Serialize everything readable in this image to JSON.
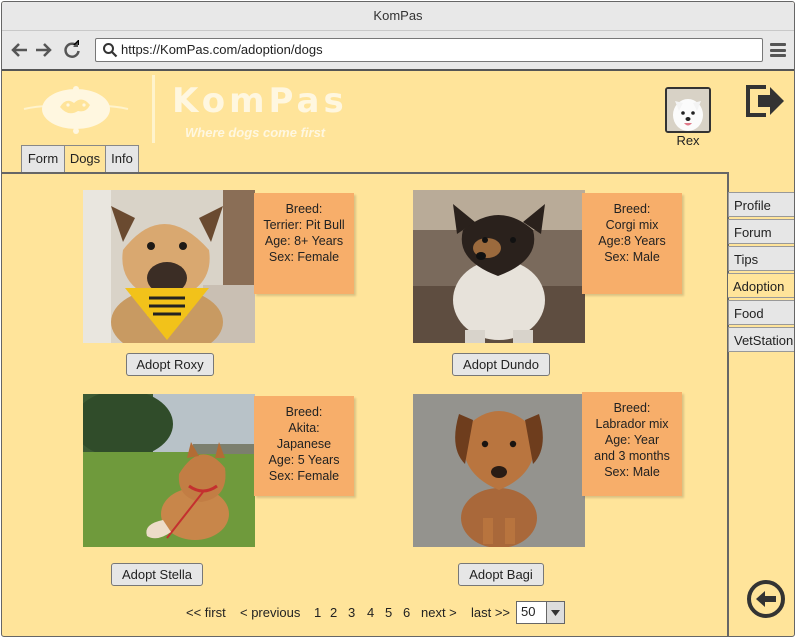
{
  "window": {
    "title": "KomPas"
  },
  "browser": {
    "url": "https://KomPas.com/adoption/dogs"
  },
  "header": {
    "brand": "KomPas",
    "tagline": "Where dogs come first",
    "user_name": "Rex"
  },
  "tabs": [
    {
      "label": "Form",
      "active": false
    },
    {
      "label": "Dogs",
      "active": true
    },
    {
      "label": "Info",
      "active": false
    }
  ],
  "sidebar": [
    {
      "label": "Profile",
      "active": false
    },
    {
      "label": "Forum",
      "active": false
    },
    {
      "label": "Tips",
      "active": false
    },
    {
      "label": "Adoption",
      "active": true
    },
    {
      "label": "Food",
      "active": false
    },
    {
      "label": "VetStation",
      "active": false
    }
  ],
  "dogs": [
    {
      "name": "Roxy",
      "note": [
        "Breed:",
        "Terrier: Pit Bull",
        "Age: 8+ Years",
        "Sex: Female"
      ],
      "button": "Adopt Roxy"
    },
    {
      "name": "Dundo",
      "note": [
        "Breed:",
        "Corgi mix",
        "Age:8 Years",
        "Sex: Male"
      ],
      "button": "Adopt Dundo"
    },
    {
      "name": "Stella",
      "note": [
        "Breed:",
        "Akita:",
        "Japanese",
        "Age: 5  Years",
        "Sex: Female"
      ],
      "button": "Adopt Stella"
    },
    {
      "name": "Bagi",
      "note": [
        "Breed:",
        "Labrador mix",
        "Age:  Year",
        "and 3 months",
        "Sex: Male"
      ],
      "button": "Adopt Bagi"
    }
  ],
  "pagination": {
    "first": "<< first",
    "previous": "< previous",
    "current": "1",
    "pages": [
      "2",
      "3",
      "4",
      "5",
      "6"
    ],
    "next": "next >",
    "last": "last >>",
    "per_page": "50"
  },
  "colors": {
    "background": "#ffe49a",
    "note": "#f7ae6a",
    "link": "#2a4a8a"
  }
}
